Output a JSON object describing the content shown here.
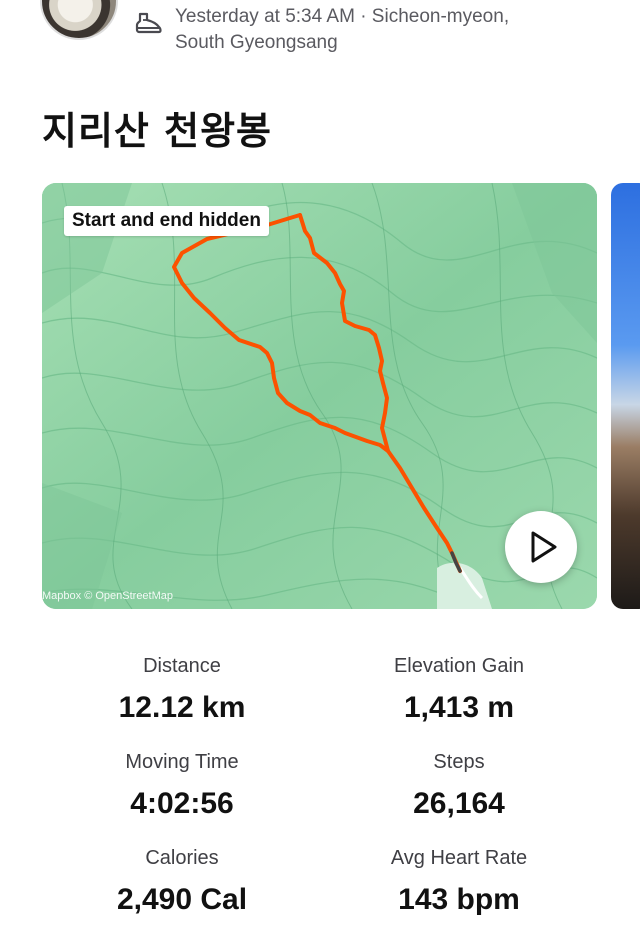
{
  "header": {
    "meta_line1": "Yesterday at 5:34 AM · Sicheon-myeon,",
    "meta_line2": "South Gyeongsang",
    "activity_icon": "hiking-shoe-icon",
    "avatar_icon": "avatar"
  },
  "activity": {
    "title": "지리산 천왕봉"
  },
  "map": {
    "privacy_label": "Start and end hidden",
    "attribution": "Mapbox © OpenStreetMap",
    "route_color": "#fc5200",
    "play_icon": "play-icon"
  },
  "stats": [
    {
      "label": "Distance",
      "value": "12.12 km"
    },
    {
      "label": "Elevation Gain",
      "value": "1,413 m"
    },
    {
      "label": "Moving Time",
      "value": "4:02:56"
    },
    {
      "label": "Steps",
      "value": "26,164"
    },
    {
      "label": "Calories",
      "value": "2,490 Cal"
    },
    {
      "label": "Avg Heart Rate",
      "value": "143 bpm"
    }
  ]
}
